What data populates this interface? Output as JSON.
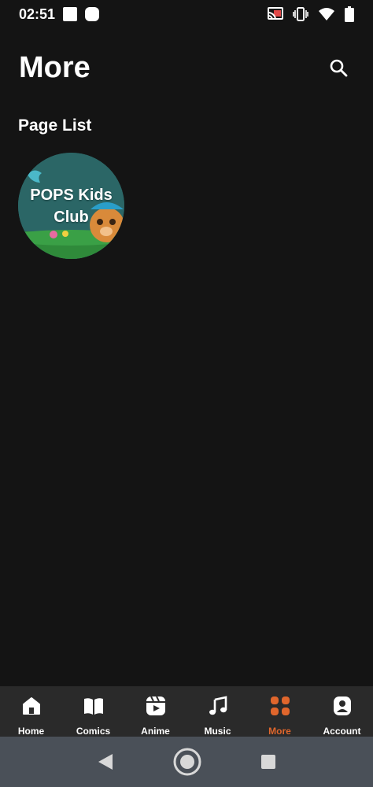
{
  "status_bar": {
    "time": "02:51"
  },
  "header": {
    "title": "More"
  },
  "section": {
    "title": "Page List"
  },
  "pages": [
    {
      "label": "POPS Kids Club"
    }
  ],
  "bottom_nav": {
    "items": [
      {
        "label": "Home",
        "icon": "home-icon"
      },
      {
        "label": "Comics",
        "icon": "book-icon"
      },
      {
        "label": "Anime",
        "icon": "reel-icon"
      },
      {
        "label": "Music",
        "icon": "music-note-icon"
      },
      {
        "label": "More",
        "icon": "grid-icon",
        "active": true
      },
      {
        "label": "Account",
        "icon": "account-icon"
      }
    ],
    "active_color": "#e0662c"
  },
  "colors": {
    "background": "#141414",
    "nav_background": "#2a2a2a",
    "system_nav_background": "#4a5058",
    "accent": "#e0662c"
  }
}
